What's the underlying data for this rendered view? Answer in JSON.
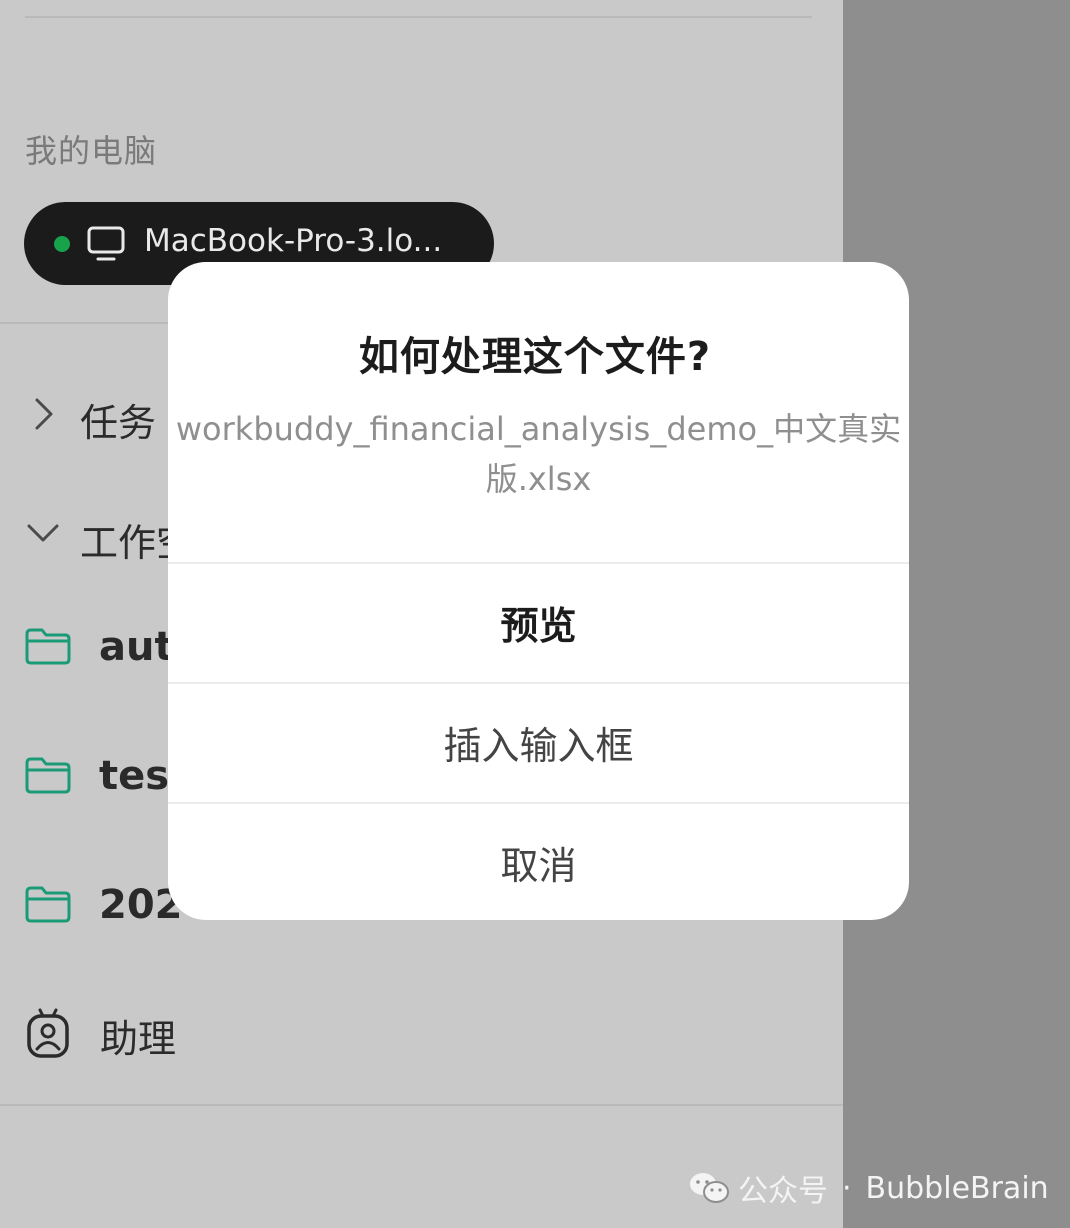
{
  "sidebar": {
    "section_label": "我的电脑",
    "device": {
      "name": "MacBook-Pro-3.lo...",
      "status_color": "#16a34a",
      "icon": "monitor-icon"
    },
    "nav": {
      "tasks_label": "任务",
      "workspace_label": "工作空"
    },
    "folders": [
      {
        "name": "aut",
        "icon": "folder-icon"
      },
      {
        "name": "tes",
        "icon": "folder-icon"
      },
      {
        "name": "202",
        "icon": "folder-icon"
      }
    ],
    "assistant_label": "助理"
  },
  "dialog": {
    "title": "如何处理这个文件?",
    "filename": "workbuddy_financial_analysis_demo_中文真实版.xlsx",
    "actions": {
      "preview": "预览",
      "insert": "插入输入框",
      "cancel": "取消"
    }
  },
  "watermark": {
    "prefix": "公众号",
    "separator": "·",
    "name": "BubbleBrain",
    "icon": "wechat-icon"
  },
  "colors": {
    "accent": "#1a9a77",
    "status_online": "#16a34a",
    "sidebar_bg": "#c9c9c9",
    "overlay_bg": "#8e8e8e"
  }
}
